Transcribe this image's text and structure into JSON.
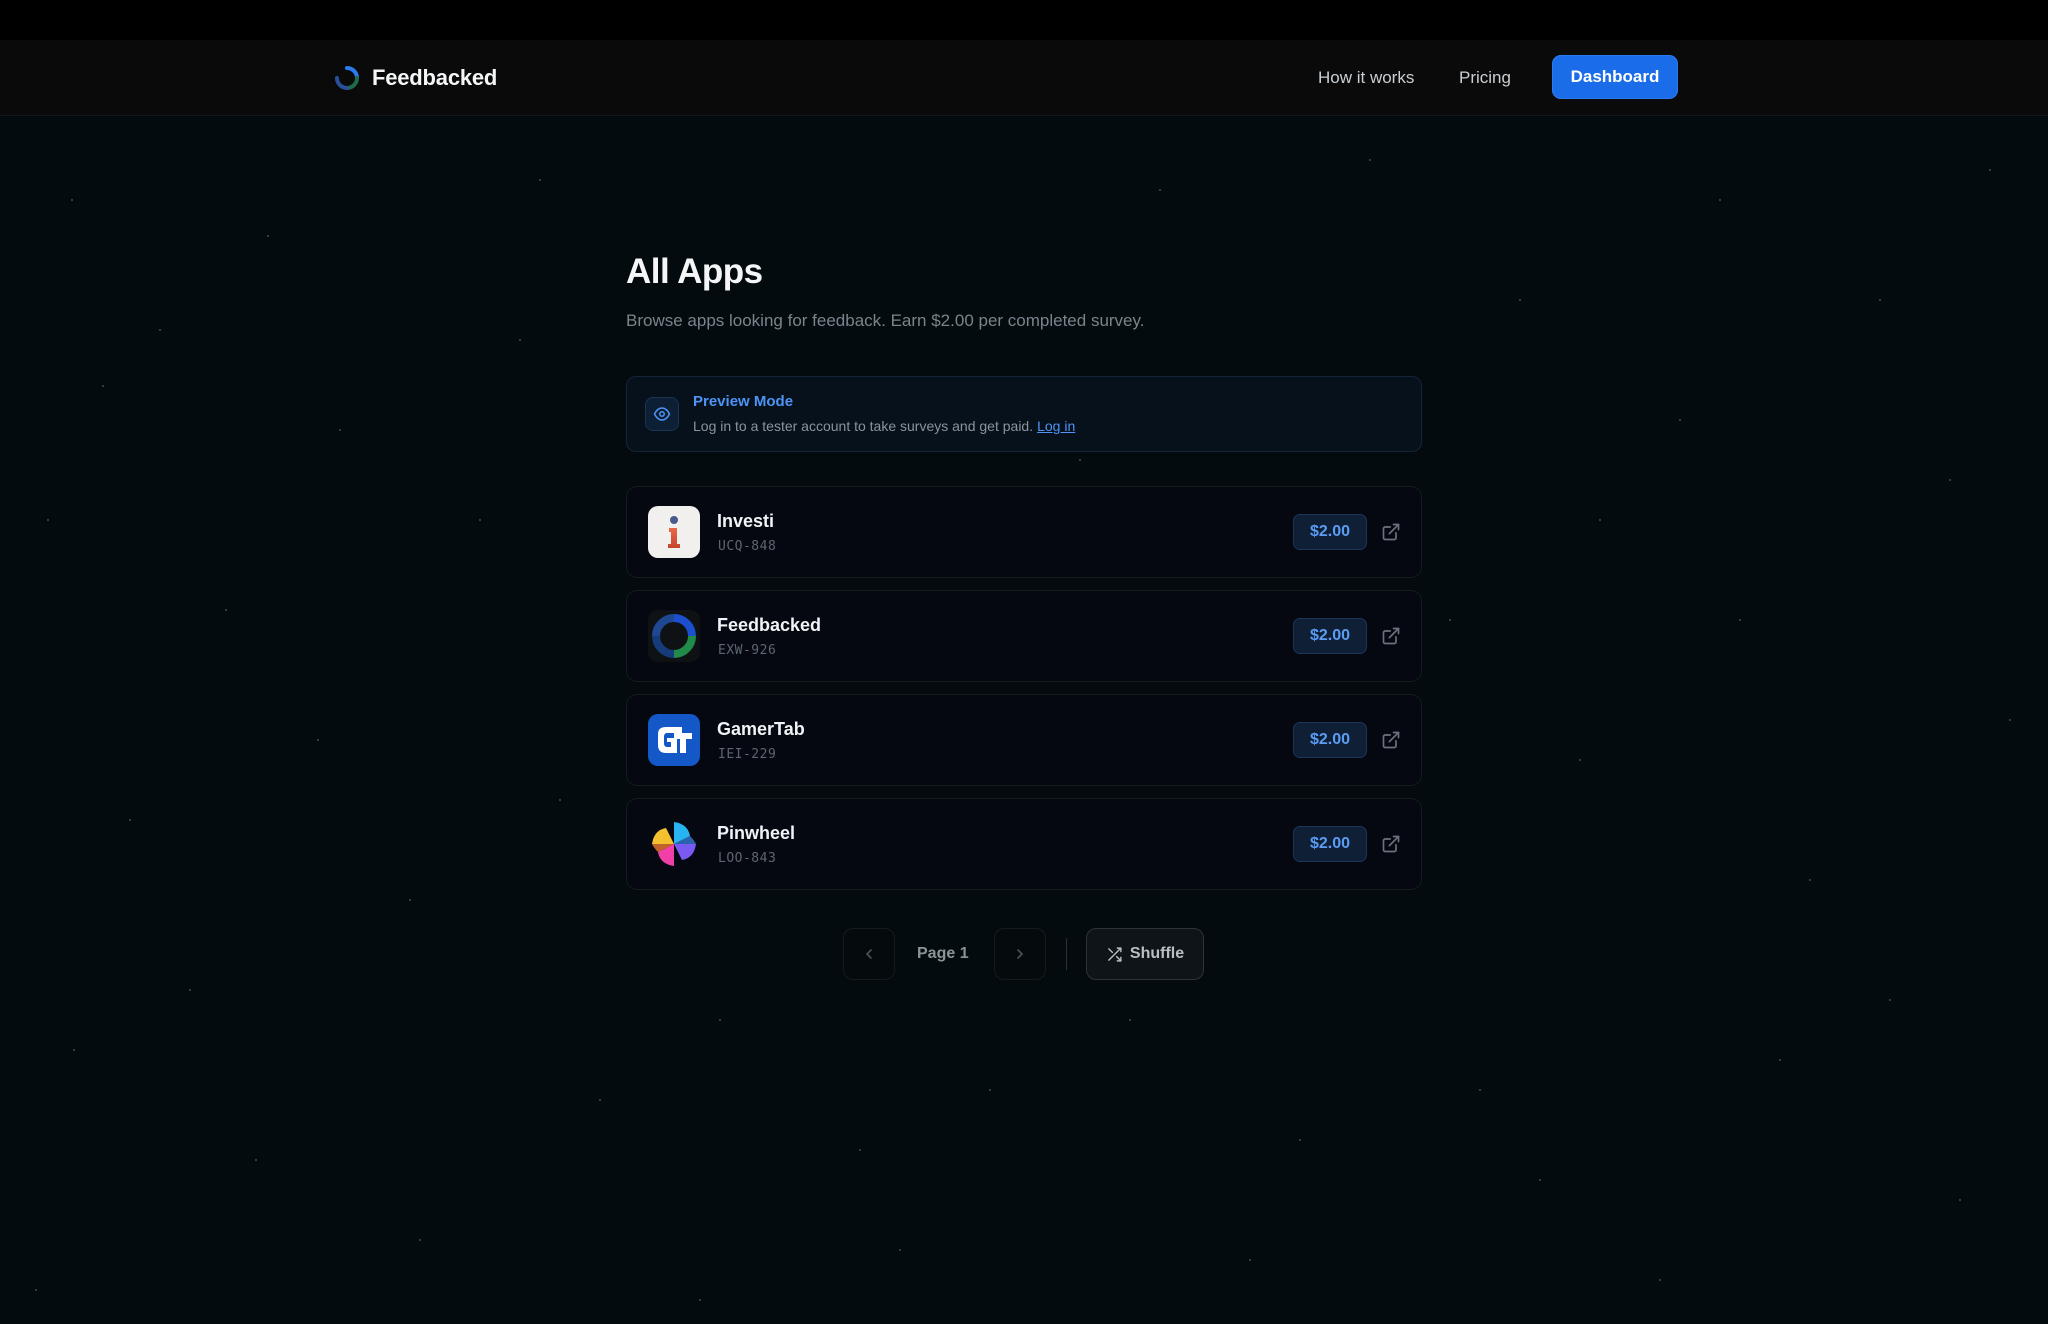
{
  "nav": {
    "brand": "Feedbacked",
    "links": [
      "How it works",
      "Pricing"
    ],
    "dashboard_label": "Dashboard"
  },
  "page": {
    "title": "All Apps",
    "subtitle": "Browse apps looking for feedback. Earn $2.00 per completed survey."
  },
  "preview": {
    "title": "Preview Mode",
    "text": "Log in to a tester account to take surveys and get paid.",
    "link": "Log in"
  },
  "apps": [
    {
      "name": "Investi",
      "code": "UCQ-848",
      "price": "$2.00"
    },
    {
      "name": "Feedbacked",
      "code": "EXW-926",
      "price": "$2.00"
    },
    {
      "name": "GamerTab",
      "code": "IEI-229",
      "price": "$2.00"
    },
    {
      "name": "Pinwheel",
      "code": "LOO-843",
      "price": "$2.00"
    }
  ],
  "pagination": {
    "page_label": "Page 1",
    "shuffle_label": "Shuffle"
  },
  "colors": {
    "background": "#030b0e",
    "accent": "#1a6ce8",
    "price_text": "#5b9cf5"
  }
}
